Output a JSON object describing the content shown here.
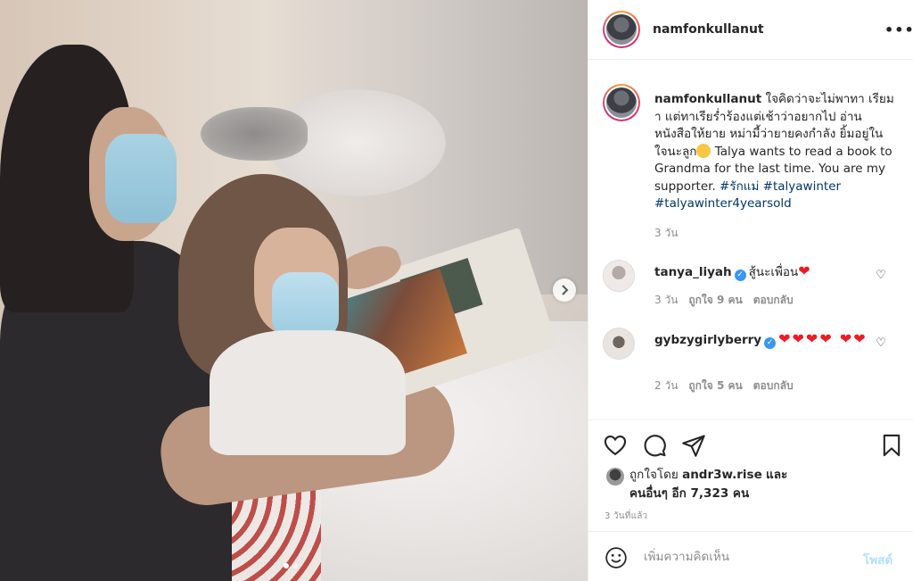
{
  "post": {
    "username": "namfonkullanut",
    "more_icon": "more-horizontal-icon"
  },
  "caption": {
    "username": "namfonkullanut",
    "text_1": "ใจคิดว่าจะไม่พาทา เรียมา แต่ทาเรียร่ำร้องแต่เช้าว่าอยากไป อ่านหนังสือให้ยาย หม่ามี้ว่ายายคงกำลัง ยิ้มอยู่ในใจนะลูก",
    "text_2": " Talya wants to read a book to Grandma for the last time. You are my supporter. ",
    "tag_1": "#รักแม่",
    "tag_2": "#talyawinter",
    "tag_3": "#talyawinter4yearsold",
    "time": "3 วัน"
  },
  "comments": [
    {
      "username": "tanya_liyah",
      "verified": true,
      "text": "สู้นะเพื่อน",
      "hearts": "❤",
      "time": "3 วัน",
      "likes": "ถูกใจ 9 คน",
      "reply": "ตอบกลับ"
    },
    {
      "username": "gybzygirlyberry",
      "verified": true,
      "text": "",
      "hearts": "❤❤❤❤ ❤❤",
      "time": "2 วัน",
      "likes": "ถูกใจ 5 คน",
      "reply": "ตอบกลับ"
    }
  ],
  "likes": {
    "prefix": "ถูกใจโดย",
    "user": "andr3w.rise",
    "and": "และ",
    "others": "คนอื่นๆ อีก 7,323 คน"
  },
  "post_time": "3 วันที่แล้ว",
  "add_comment": {
    "placeholder": "เพิ่มความคิดเห็น",
    "post_label": "โพสต์"
  },
  "carousel": {
    "slide_count": 2,
    "active_index": 0
  },
  "colors": {
    "link": "#00376b",
    "verified": "#3897f0",
    "heart": "#ed1c24",
    "post_button_disabled": "#b2dffc"
  }
}
